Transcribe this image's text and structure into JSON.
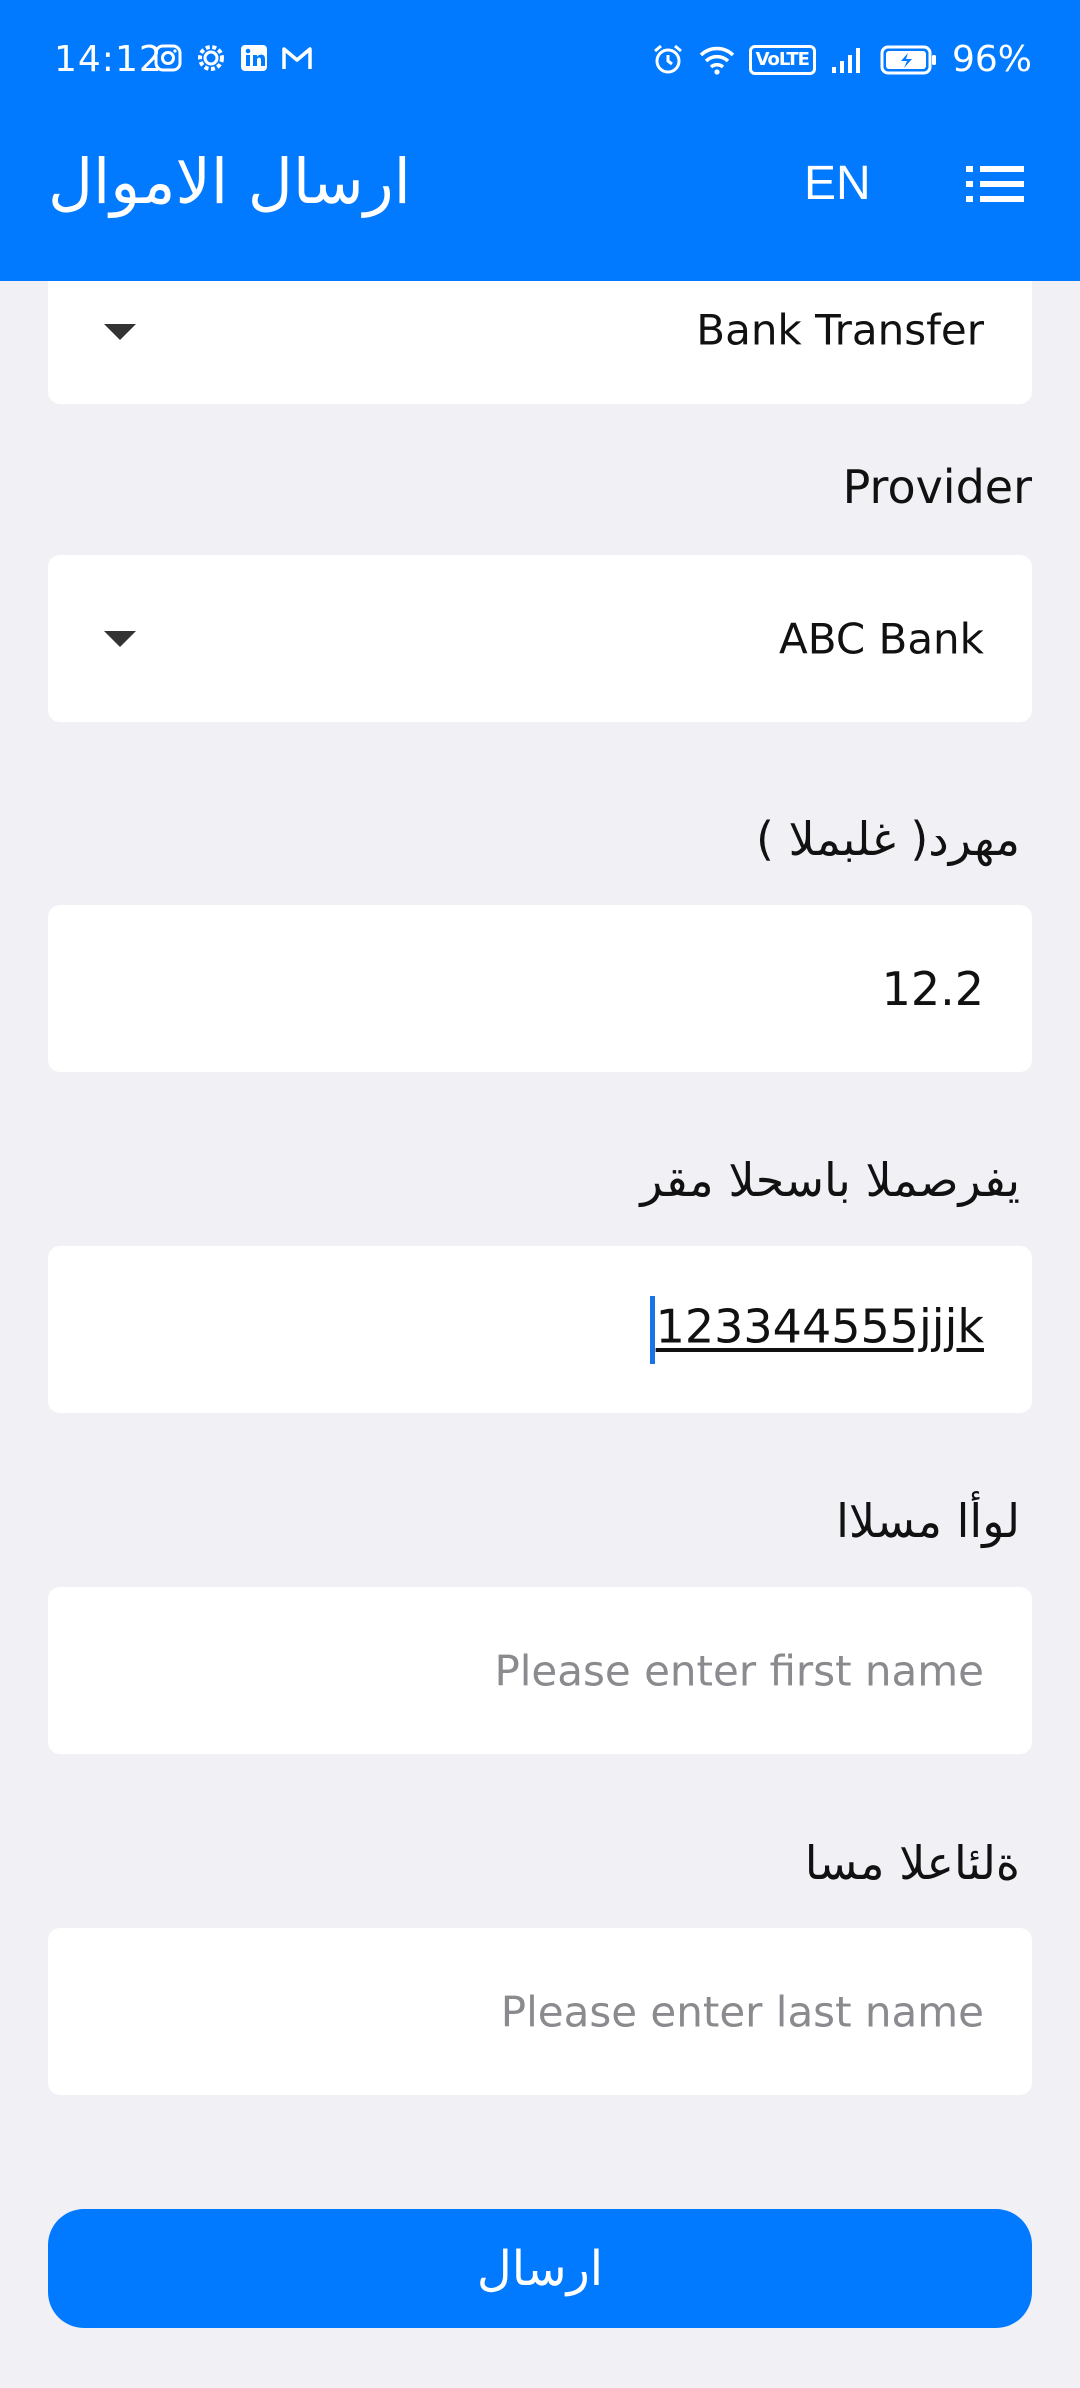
{
  "status_bar": {
    "time": "14:12",
    "left_icons": [
      "instagram-icon",
      "settings-cog-icon",
      "linkedin-icon",
      "gmail-icon"
    ],
    "right_icons": [
      "alarm-icon",
      "wifi-icon",
      "volte-badge",
      "signal-icon",
      "battery-charging-icon"
    ],
    "volte_label": "VoLTE",
    "battery_percent": "96%"
  },
  "header": {
    "title": "ارسال الاموال",
    "language_button": "EN",
    "menu_icon": "menu-list-icon"
  },
  "form": {
    "transfer_type": {
      "value": "Bank Transfer",
      "icon": "dropdown-caret-icon"
    },
    "provider": {
      "label": "Provider",
      "value": "ABC Bank",
      "icon": "dropdown-caret-icon"
    },
    "amount": {
      "label": "مهرد( غلبملا )",
      "value": "12.2"
    },
    "account_number": {
      "label": "يفرصملا باسحلا مقر",
      "value": "123344555jjjk"
    },
    "first_name": {
      "label": "لوأا مسلاا",
      "placeholder": "Please enter first name"
    },
    "last_name": {
      "label": "ةلئاعلا مسا",
      "placeholder": "Please enter last name"
    },
    "submit_label": "ارسال"
  },
  "colors": {
    "primary": "#027aff",
    "background": "#f0f0f5",
    "field": "#ffffff",
    "placeholder": "#8a8a8f",
    "cursor": "#1a73e8"
  }
}
